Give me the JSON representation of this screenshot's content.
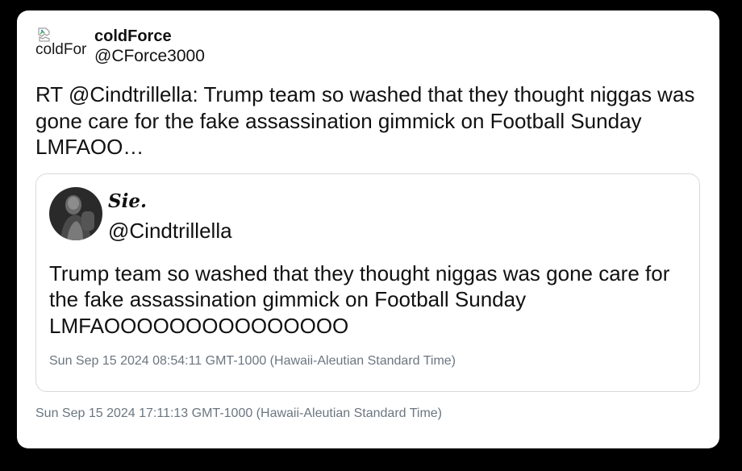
{
  "tweet": {
    "avatar_alt": "coldForce",
    "display_name": "coldForce",
    "handle": "@CForce3000",
    "text": "RT @Cindtrillella: Trump team so washed that they thought niggas was gone care for the fake assassination gimmick on Football Sunday LMFAOO…",
    "timestamp": "Sun Sep 15 2024 17:11:13 GMT-1000 (Hawaii-Aleutian Standard Time)"
  },
  "quoted_tweet": {
    "display_name": "𝑺𝒊𝒆.",
    "handle": "@Cindtrillella",
    "text": "Trump team so washed that they thought niggas was gone care for the fake assassination gimmick on Football Sunday LMFAOOOOOOOOOOOOOOO",
    "timestamp": "Sun Sep 15 2024 08:54:11 GMT-1000 (Hawaii-Aleutian Standard Time)"
  },
  "icons": {
    "broken_image": "broken-image-icon"
  },
  "colors": {
    "background": "#000000",
    "card": "#ffffff",
    "text": "#111111",
    "muted": "#6b7680",
    "border": "#d9d9d9"
  }
}
